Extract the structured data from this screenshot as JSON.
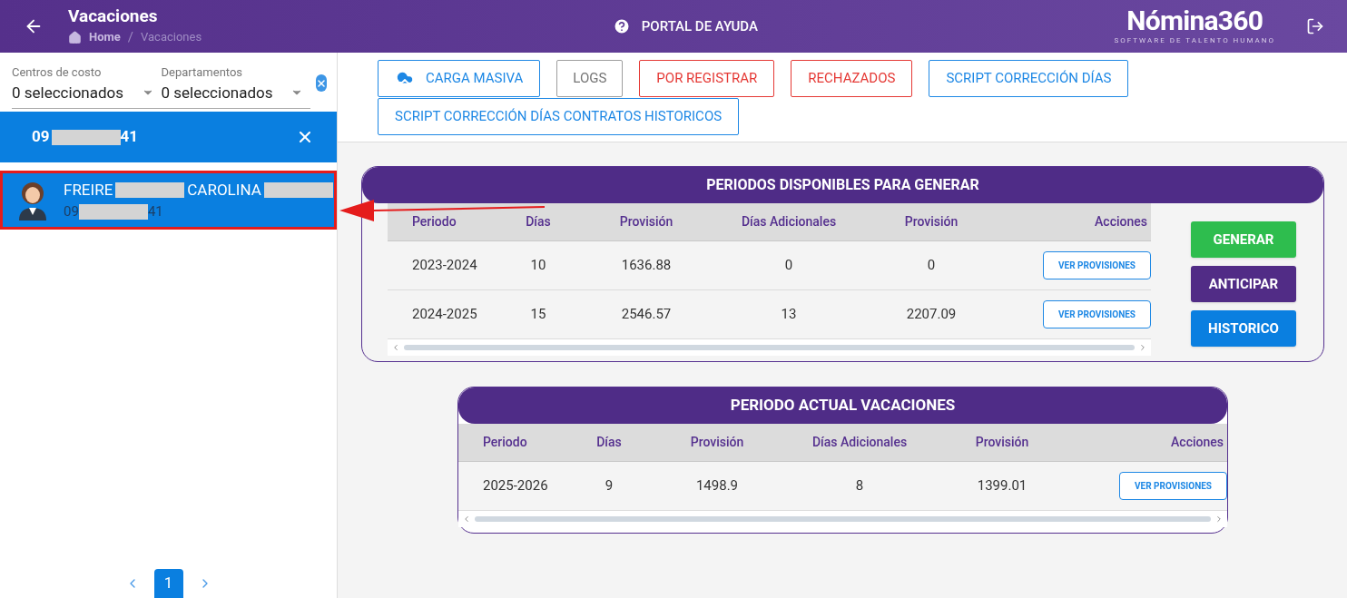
{
  "header": {
    "title": "Vacaciones",
    "breadcrumb_separator": "/",
    "breadcrumb": [
      {
        "label": "Home",
        "selected": false
      },
      {
        "label": "Vacaciones",
        "selected": true
      }
    ],
    "help": "PORTAL DE AYUDA",
    "logo": {
      "name": "Nómina360",
      "tagline": "SOFTWARE DE TALENTO HUMANO"
    }
  },
  "filters": [
    {
      "label": "Centros de costo",
      "value": "0 seleccionados"
    },
    {
      "label": "Departamentos",
      "value": "0 seleccionados"
    }
  ],
  "search_chip": {
    "prefix": "09",
    "suffix": "41"
  },
  "employees": [
    {
      "name_parts": [
        "FREIRE",
        "CAROLINA"
      ],
      "id_prefix": "09",
      "id_suffix": "41",
      "selected": true,
      "highlighted": true
    }
  ],
  "pagination": {
    "pages": [
      {
        "label": "1",
        "selected": true
      }
    ]
  },
  "toolbar": [
    {
      "label": "CARGA MASIVA",
      "kind": "upload"
    },
    {
      "label": "LOGS",
      "kind": "neutral"
    },
    {
      "label": "POR REGISTRAR",
      "kind": "danger"
    },
    {
      "label": "RECHAZADOS",
      "kind": "danger"
    },
    {
      "label": "SCRIPT CORRECCIÓN DÍAS",
      "kind": "primary"
    },
    {
      "label": "SCRIPT CORRECCIÓN DÍAS CONTRATOS HISTORICOS",
      "kind": "primary"
    }
  ],
  "available": {
    "title": "PERIODOS DISPONIBLES PARA GENERAR",
    "columns": [
      "Periodo",
      "Días",
      "Provisión",
      "Días Adicionales",
      "Provisión",
      "Acciones"
    ],
    "rows": [
      {
        "cells": [
          "2023-2024",
          "10",
          "1636.88",
          "0",
          "0"
        ],
        "action": "VER PROVISIONES"
      },
      {
        "cells": [
          "2024-2025",
          "15",
          "2546.57",
          "13",
          "2207.09"
        ],
        "action": "VER PROVISIONES"
      }
    ],
    "buttons": [
      {
        "label": "GENERAR",
        "kind": "success"
      },
      {
        "label": "ANTICIPAR",
        "kind": "purple"
      },
      {
        "label": "HISTORICO",
        "kind": "primary"
      }
    ]
  },
  "current": {
    "title": "PERIODO ACTUAL VACACIONES",
    "columns": [
      "Periodo",
      "Días",
      "Provisión",
      "Días Adicionales",
      "Provisión",
      "Acciones"
    ],
    "rows": [
      {
        "cells": [
          "2025-2026",
          "9",
          "1498.9",
          "8",
          "1399.01"
        ],
        "action": "VER PROVISIONES"
      }
    ]
  }
}
